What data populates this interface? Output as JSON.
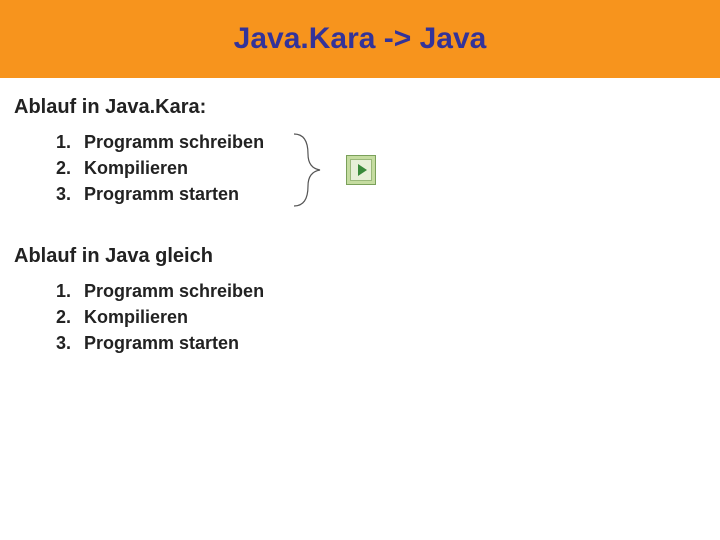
{
  "header": {
    "title": "Java.Kara -> Java"
  },
  "section1": {
    "heading": "Ablauf in Java.Kara:",
    "items": [
      {
        "num": "1.",
        "text": "Programm schreiben"
      },
      {
        "num": "2.",
        "text": "Kompilieren"
      },
      {
        "num": "3.",
        "text": "Programm starten"
      }
    ]
  },
  "section2": {
    "heading": "Ablauf in Java gleich",
    "items": [
      {
        "num": "1.",
        "text": "Programm schreiben"
      },
      {
        "num": "2.",
        "text": "Kompilieren"
      },
      {
        "num": "3.",
        "text": "Programm starten"
      }
    ]
  },
  "icons": {
    "play": "play-icon"
  }
}
